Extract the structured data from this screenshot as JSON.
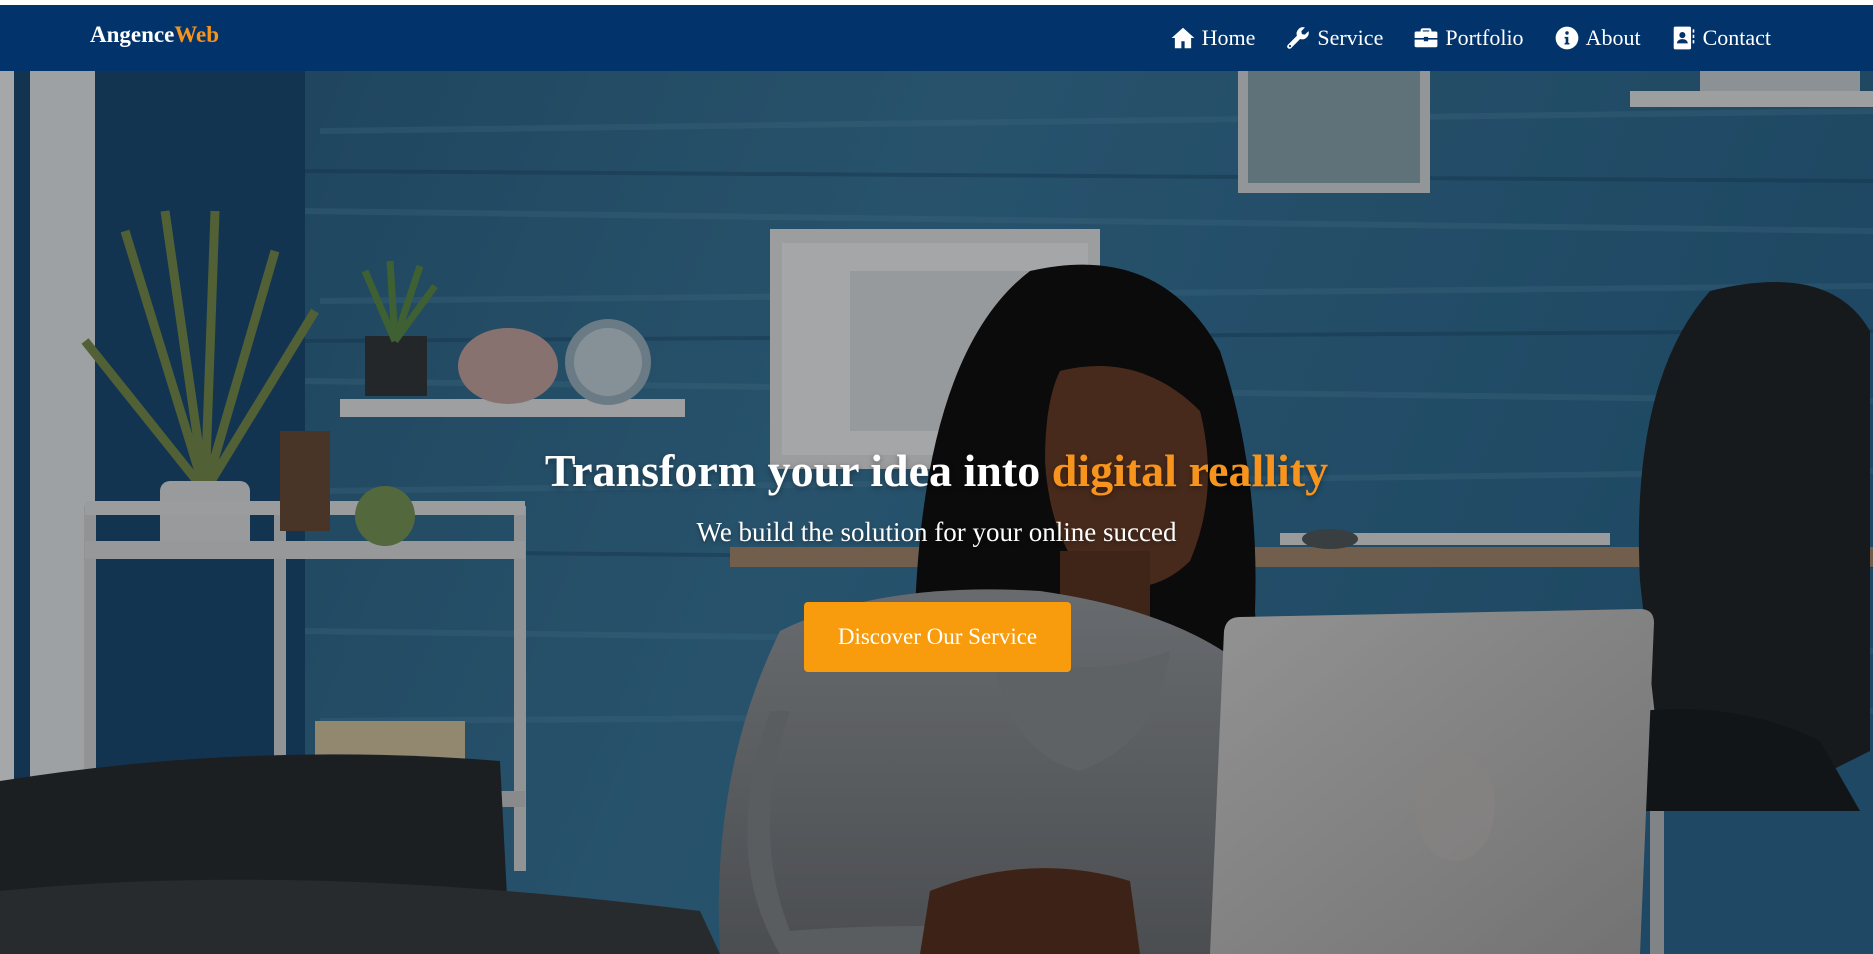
{
  "brand": {
    "name_part1": "Angence",
    "name_part2": "Web",
    "accent_color": "#f7941d"
  },
  "nav": {
    "items": [
      {
        "label": "Home",
        "icon": "home-icon"
      },
      {
        "label": "Service",
        "icon": "wrench-icon"
      },
      {
        "label": "Portfolio",
        "icon": "briefcase-icon"
      },
      {
        "label": "About",
        "icon": "info-circle-icon"
      },
      {
        "label": "Contact",
        "icon": "contact-card-icon"
      }
    ],
    "background_color": "#02346b"
  },
  "hero": {
    "title_main": "Transform your idea into ",
    "title_highlight": "digital reallity",
    "subtitle": "We build the solution for your online succed",
    "cta_label": "Discover Our Service",
    "cta_color": "#f89c0e",
    "background_image": "woman-working-on-laptop-in-blue-office"
  }
}
